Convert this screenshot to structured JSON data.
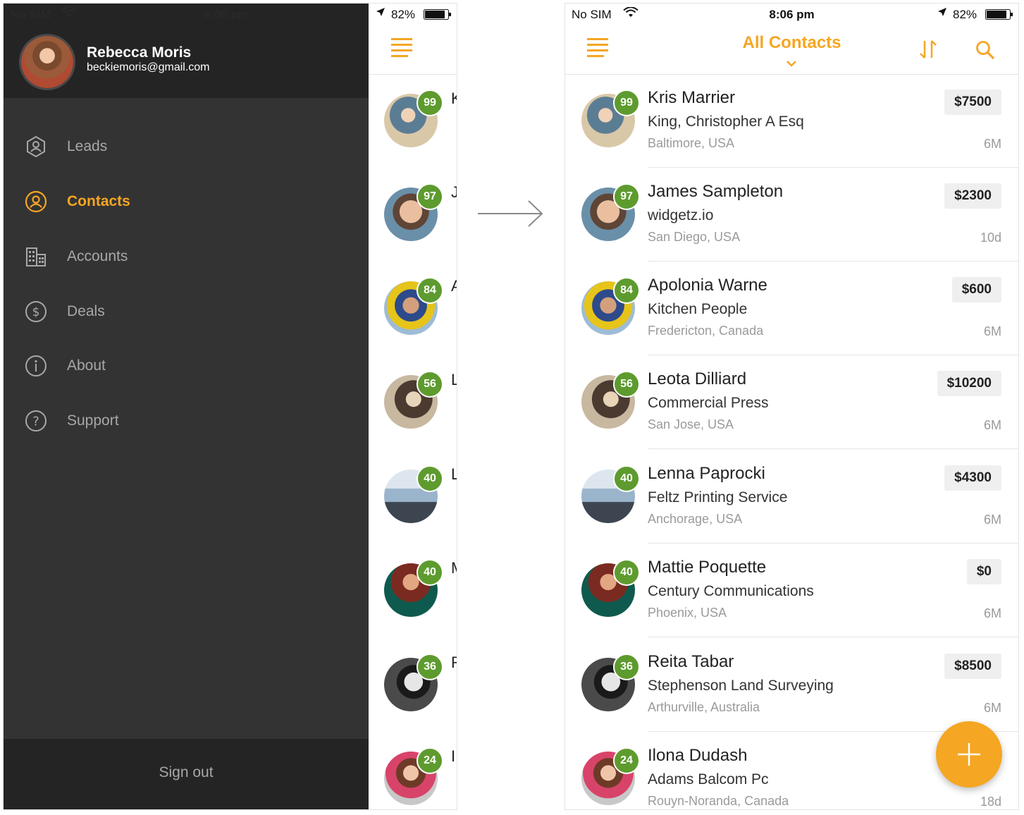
{
  "status_bar": {
    "carrier": "No SIM",
    "time": "8:06 pm",
    "battery": "82%"
  },
  "drawer": {
    "profile": {
      "name": "Rebecca Moris",
      "email": "beckiemoris@gmail.com"
    },
    "menu": [
      {
        "label": "Leads",
        "icon": "leads-icon"
      },
      {
        "label": "Contacts",
        "icon": "contacts-icon",
        "active": true
      },
      {
        "label": "Accounts",
        "icon": "building-icon"
      },
      {
        "label": "Deals",
        "icon": "dollar-icon"
      },
      {
        "label": "About",
        "icon": "info-icon"
      },
      {
        "label": "Support",
        "icon": "help-icon"
      }
    ],
    "sign_out": "Sign out"
  },
  "peek_letters": [
    "K",
    "J",
    "A",
    "L",
    "L",
    "M",
    "R",
    "I"
  ],
  "contacts_screen": {
    "title": "All Contacts",
    "accent": "#f5a623",
    "score_color": "#5e9b2e",
    "contacts": [
      {
        "score": "99",
        "name": "Kris Marrier",
        "company": "King, Christopher A Esq",
        "location": "Baltimore, USA",
        "amount": "$7500",
        "age": "6M"
      },
      {
        "score": "97",
        "name": "James Sampleton",
        "company": "widgetz.io",
        "location": "San Diego, USA",
        "amount": "$2300",
        "age": "10d"
      },
      {
        "score": "84",
        "name": "Apolonia Warne",
        "company": "Kitchen People",
        "location": "Fredericton, Canada",
        "amount": "$600",
        "age": "6M"
      },
      {
        "score": "56",
        "name": "Leota Dilliard",
        "company": "Commercial Press",
        "location": "San Jose, USA",
        "amount": "$10200",
        "age": "6M"
      },
      {
        "score": "40",
        "name": "Lenna Paprocki",
        "company": "Feltz Printing Service",
        "location": "Anchorage, USA",
        "amount": "$4300",
        "age": "6M"
      },
      {
        "score": "40",
        "name": "Mattie Poquette",
        "company": "Century Communications",
        "location": "Phoenix, USA",
        "amount": "$0",
        "age": "6M"
      },
      {
        "score": "36",
        "name": "Reita Tabar",
        "company": "Stephenson Land Surveying",
        "location": "Arthurville, Australia",
        "amount": "$8500",
        "age": "6M"
      },
      {
        "score": "24",
        "name": "Ilona Dudash",
        "company": "Adams Balcom Pc",
        "location": "Rouyn-Noranda, Canada",
        "amount": "",
        "age": "18d"
      }
    ]
  }
}
